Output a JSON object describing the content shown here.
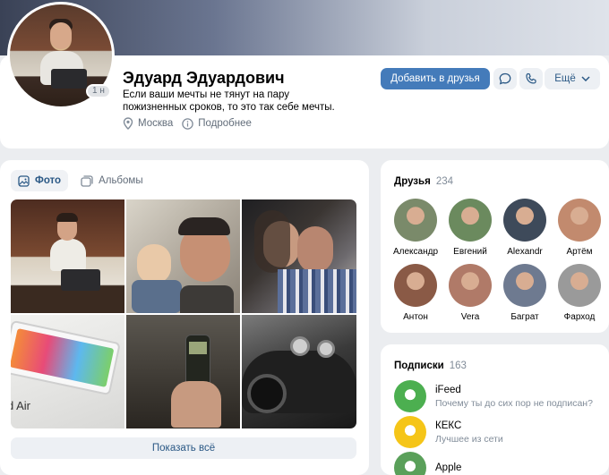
{
  "profile": {
    "name": "Эдуард Эдуардович",
    "status": "Если ваши мечты не тянут на пару пожизненных сроков, то это так себе мечты.",
    "online_badge": "1 н",
    "city": "Москва",
    "details_link": "Подробнее",
    "add_friend_label": "Добавить в друзья",
    "more_label": "Ещё"
  },
  "photos": {
    "tabs": [
      {
        "label": "Фото",
        "icon": "photo-icon",
        "active": true
      },
      {
        "label": "Альбомы",
        "icon": "albums-icon",
        "active": false
      }
    ],
    "show_all_label": "Показать всё"
  },
  "friends": {
    "title": "Друзья",
    "count": "234",
    "items": [
      {
        "name": "Александр",
        "color": "#7a8a6a"
      },
      {
        "name": "Евгений",
        "color": "#6b8a5e"
      },
      {
        "name": "Alexandr",
        "color": "#3e4a5a"
      },
      {
        "name": "Артём",
        "color": "#c28a6e"
      },
      {
        "name": "Антон",
        "color": "#8a5a46"
      },
      {
        "name": "Vera",
        "color": "#b07a68"
      },
      {
        "name": "Баграт",
        "color": "#6e7a90"
      },
      {
        "name": "Фарход",
        "color": "#9a9a9a"
      }
    ]
  },
  "subscriptions": {
    "title": "Подписки",
    "count": "163",
    "items": [
      {
        "name": "iFeed",
        "desc": "Почему ты до сих пор не подписан?",
        "color": "#4caf50"
      },
      {
        "name": "КЕКС",
        "desc": "Лучшее из сети",
        "color": "#f5c518"
      },
      {
        "name": "Apple",
        "desc": "",
        "color": "#5aa05a"
      }
    ]
  }
}
